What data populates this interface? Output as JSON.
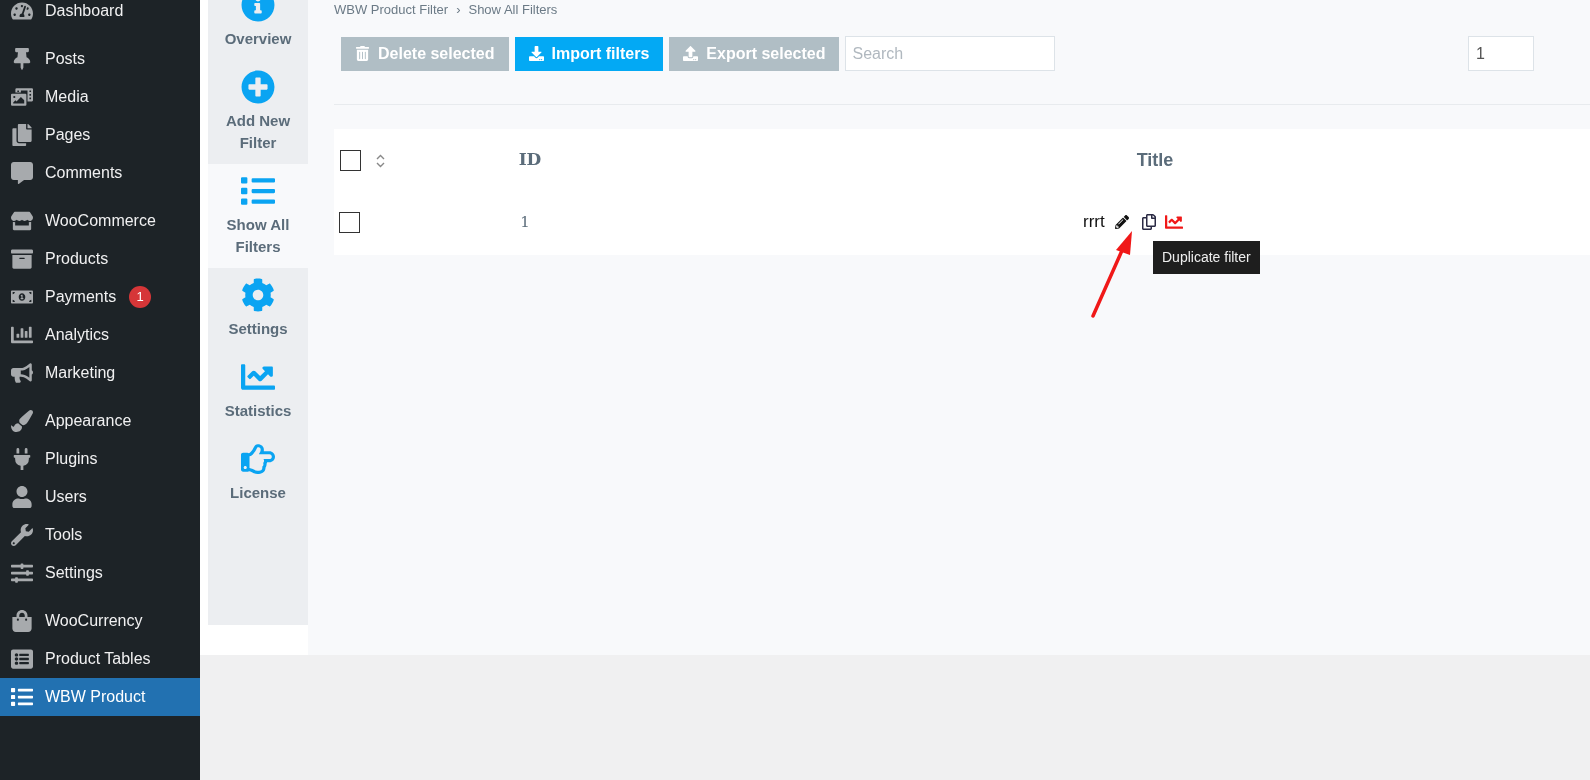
{
  "admin_menu": [
    {
      "items": [
        {
          "label": "Dashboard",
          "selected": false
        }
      ]
    },
    {
      "items": [
        {
          "label": "Posts",
          "selected": false
        },
        {
          "label": "Media",
          "selected": false
        },
        {
          "label": "Pages",
          "selected": false
        },
        {
          "label": "Comments",
          "selected": false
        }
      ]
    },
    {
      "items": [
        {
          "label": "WooCommerce",
          "selected": false
        },
        {
          "label": "Products",
          "selected": false
        },
        {
          "label": "Payments",
          "selected": false,
          "badge": "1"
        },
        {
          "label": "Analytics",
          "selected": false
        },
        {
          "label": "Marketing",
          "selected": false
        }
      ]
    },
    {
      "items": [
        {
          "label": "Appearance",
          "selected": false
        },
        {
          "label": "Plugins",
          "selected": false
        },
        {
          "label": "Users",
          "selected": false
        },
        {
          "label": "Tools",
          "selected": false
        },
        {
          "label": "Settings",
          "selected": false
        }
      ]
    },
    {
      "items": [
        {
          "label": "WooCurrency",
          "selected": false
        },
        {
          "label": "Product Tables",
          "selected": false
        },
        {
          "label": "WBW Product",
          "selected": true
        }
      ]
    }
  ],
  "plugin_tabs": [
    {
      "label": "Overview",
      "selected": false
    },
    {
      "label": "Add New Filter",
      "selected": false
    },
    {
      "label": "Show All Filters",
      "selected": true
    },
    {
      "label": "Settings",
      "selected": false
    },
    {
      "label": "Statistics",
      "selected": false
    },
    {
      "label": "License",
      "selected": false
    }
  ],
  "breadcrumb": {
    "separator": "›",
    "items": [
      "WBW Product Filter",
      "Show All Filters"
    ]
  },
  "toolbar": {
    "buttons": [
      {
        "label": "Delete selected",
        "disabled": true
      },
      {
        "label": "Import filters",
        "disabled": false
      },
      {
        "label": "Export selected",
        "disabled": true
      }
    ],
    "search": {
      "placeholder": "Search"
    },
    "page_field": {
      "value": "1"
    }
  },
  "table": {
    "select_all": {
      "checked": false
    },
    "columns": [
      "ID",
      "Title"
    ],
    "rows": [
      {
        "checked": false,
        "id": "1",
        "title": "rrrt"
      }
    ]
  },
  "tooltip": "Duplicate filter"
}
